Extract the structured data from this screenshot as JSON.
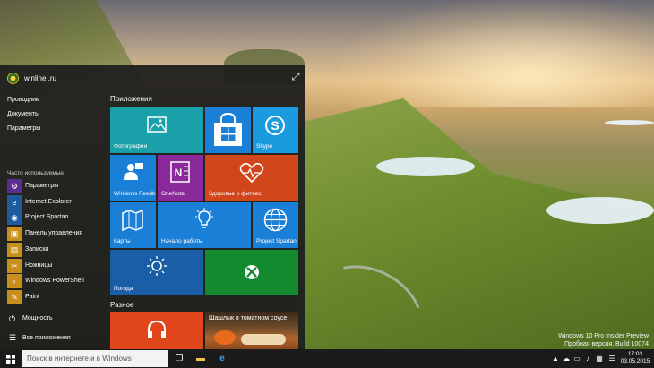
{
  "start_menu": {
    "user_name": "winline .ru",
    "places": [
      "Проводник",
      "Документы",
      "Параметры"
    ],
    "most_used_label": "Часто используемые",
    "apps": [
      {
        "label": "Параметры",
        "icon": "gear-icon",
        "color": "#5c2d91"
      },
      {
        "label": "Internet Explorer",
        "icon": "internet-explorer-icon",
        "color": "#1e5a9e"
      },
      {
        "label": "Project Spartan",
        "icon": "spartan-icon",
        "color": "#1e5a9e"
      },
      {
        "label": "Панель управления",
        "icon": "control-panel-icon",
        "color": "#c8901a"
      },
      {
        "label": "Записки",
        "icon": "sticky-notes-icon",
        "color": "#c8901a"
      },
      {
        "label": "Ножницы",
        "icon": "scissors-icon",
        "color": "#c8901a"
      },
      {
        "label": "Windows PowerShell",
        "icon": "powershell-icon",
        "color": "#c8901a"
      },
      {
        "label": "Paint",
        "icon": "paint-icon",
        "color": "#c8901a"
      }
    ],
    "power_label": "Мощность",
    "all_apps_label": "Все приложения",
    "groups": [
      "Приложения",
      "Разное"
    ],
    "tiles": {
      "photos": {
        "label": "Фотографии",
        "color": "#1aa0a8"
      },
      "store": {
        "label": "",
        "color": "#1a7fd6"
      },
      "skype": {
        "label": "Skype",
        "color": "#1a9be0"
      },
      "feedback": {
        "label": "Windows Feedb",
        "color": "#1a7fd6"
      },
      "onenote": {
        "label": "OneNote",
        "color": "#8a2a9a"
      },
      "health": {
        "label": "Здоровье и фитнес",
        "color": "#d2461c"
      },
      "maps": {
        "label": "Карты",
        "color": "#1a7fd6"
      },
      "getstarted": {
        "label": "Начало работы",
        "color": "#1a7fd6"
      },
      "spartan": {
        "label": "Project Spartan",
        "color": "#1a7fd6"
      },
      "weather": {
        "label": "Погода",
        "color": "#1a5ea8"
      },
      "xbox": {
        "label": "",
        "color": "#138a2e"
      },
      "music": {
        "label": "",
        "color": "#e0461a"
      },
      "food": {
        "label": "Шашлык в томатном соусе",
        "color": "#6b4a2a"
      }
    }
  },
  "desktop": {
    "watermark_line1": "Windows 10 Pro Insider Preview",
    "watermark_line2": "Пробная версия. Build 10074"
  },
  "taskbar": {
    "search_placeholder": "Поиск в интернете и в Windows",
    "time": "17:03",
    "date": "03.05.2015"
  }
}
